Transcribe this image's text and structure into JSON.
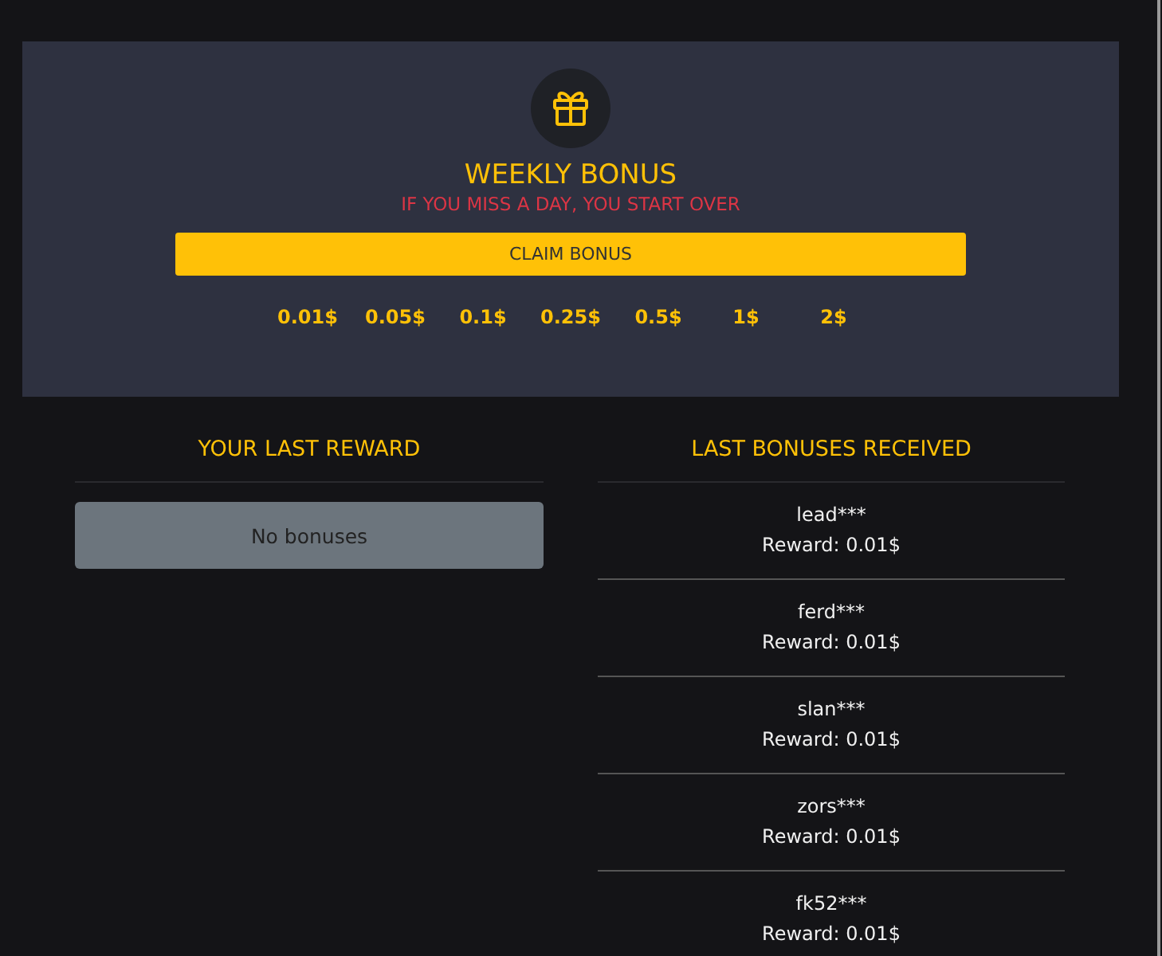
{
  "bonus_panel": {
    "title": "WEEKLY BONUS",
    "warning": "IF YOU MISS A DAY, YOU START OVER",
    "button": "CLAIM BONUS",
    "amounts": [
      "0.01$",
      "0.05$",
      "0.1$",
      "0.25$",
      "0.5$",
      "1$",
      "2$"
    ]
  },
  "last_reward": {
    "heading": "YOUR LAST REWARD",
    "message": "No bonuses"
  },
  "last_bonuses": {
    "heading": "LAST BONUSES RECEIVED",
    "items": [
      {
        "user": "lead***",
        "reward": "Reward: 0.01$"
      },
      {
        "user": "ferd***",
        "reward": "Reward: 0.01$"
      },
      {
        "user": "slan***",
        "reward": "Reward: 0.01$"
      },
      {
        "user": "zors***",
        "reward": "Reward: 0.01$"
      },
      {
        "user": "fk52***",
        "reward": "Reward: 0.01$"
      }
    ]
  }
}
